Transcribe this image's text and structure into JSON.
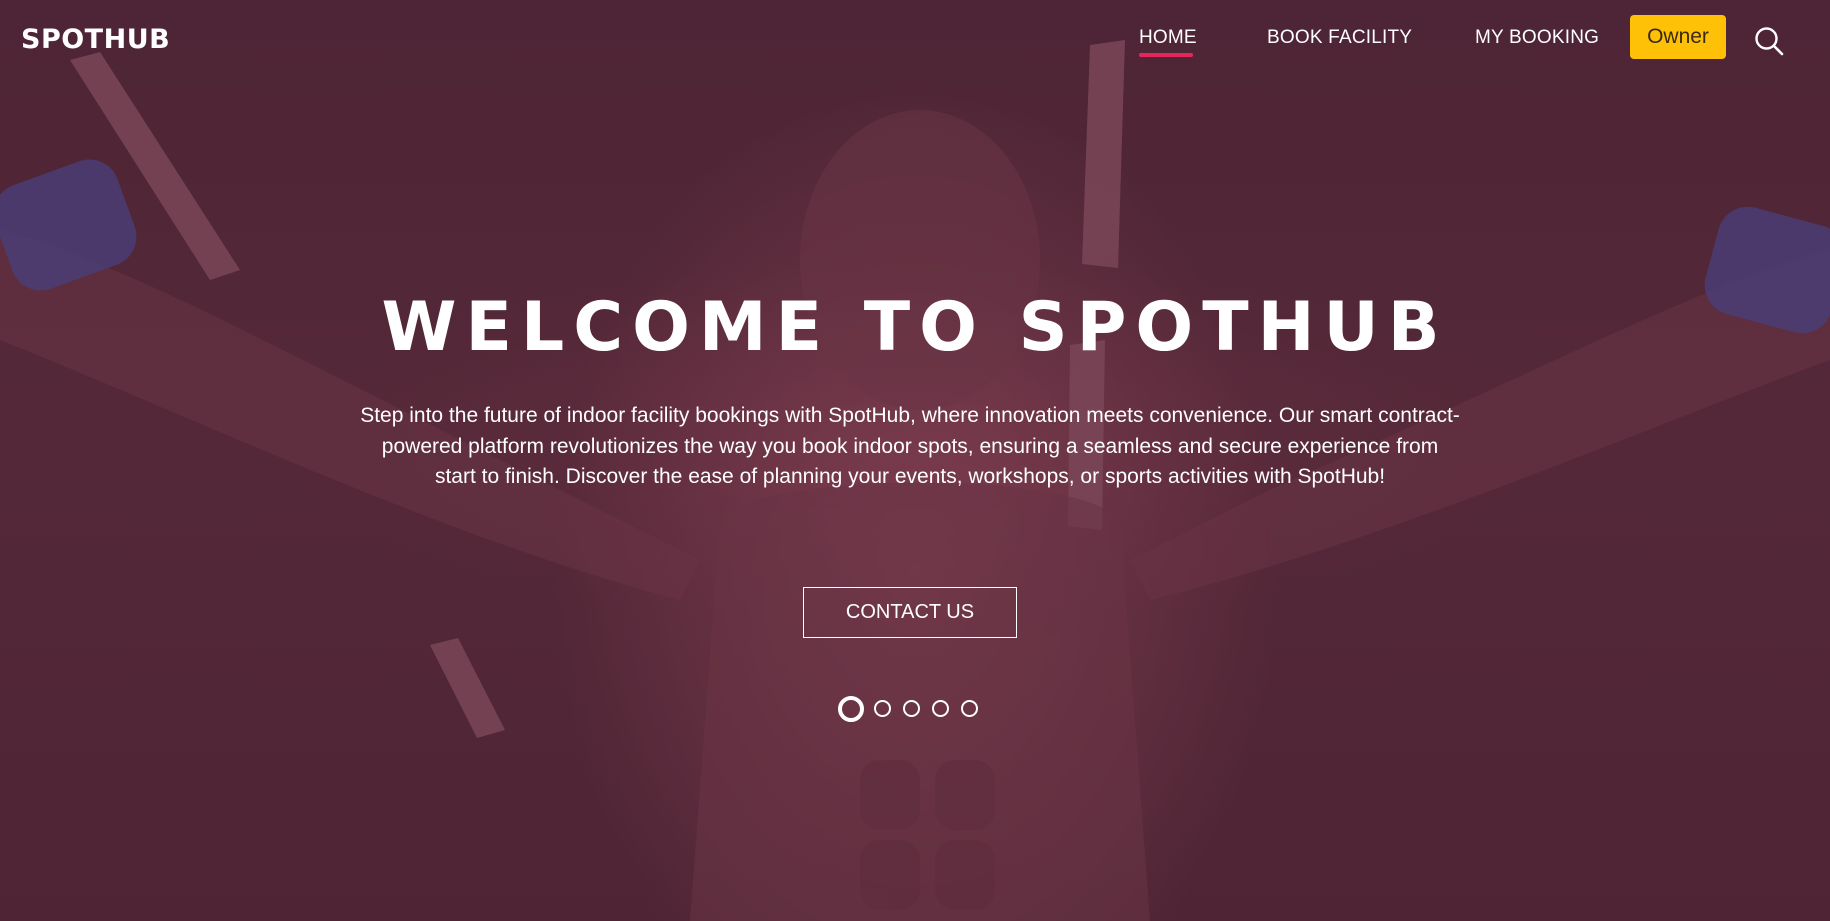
{
  "nav": {
    "brand": "SPOTHUB",
    "links": [
      {
        "label": "HOME",
        "active": true
      },
      {
        "label": "BOOK FACILITY",
        "active": false
      },
      {
        "label": "MY BOOKING",
        "active": false
      }
    ],
    "owner_label": "Owner",
    "search_icon": "search-icon"
  },
  "hero": {
    "title": "WELCOME TO SPOTHUB",
    "description": "Step into the future of indoor facility bookings with SpotHub, where innovation meets convenience. Our smart contract-powered platform revolutionizes the way you book indoor spots, ensuring a seamless and secure experience from start to finish. Discover the ease of planning your events, workshops, or sports activities with SpotHub!",
    "cta_label": "CONTACT US",
    "carousel": {
      "total": 5,
      "active_index": 0
    }
  },
  "colors": {
    "overlay": "#532636",
    "accent_underline": "#e5265b",
    "owner_button": "#ffc107",
    "text": "#ffffff"
  }
}
